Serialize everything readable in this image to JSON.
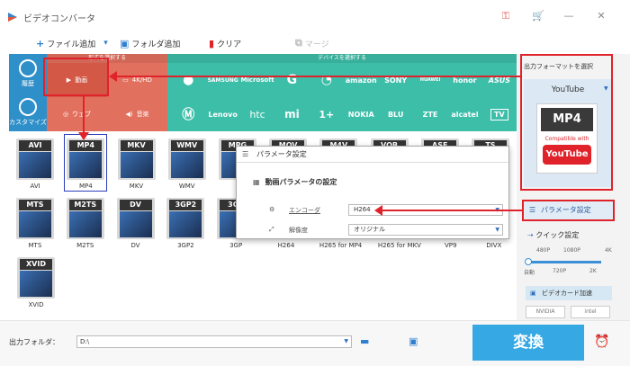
{
  "app": {
    "title": "ビデオコンバータ"
  },
  "toolbar": {
    "add_file": "ファイル追加",
    "add_folder": "フォルダ追加",
    "clear": "クリア",
    "merge": "マージ"
  },
  "nav": {
    "history": "履歴",
    "customize": "カスタマイズ"
  },
  "sections": {
    "format_header": "形式を選択する",
    "device_header": "デバイスを選択する"
  },
  "categories": [
    "動画",
    "4K/HD",
    "ウェブ",
    "音楽"
  ],
  "devices": {
    "row1": [
      "",
      "SAMSUNG",
      "Microsoft",
      "G",
      "",
      "amazon",
      "SONY",
      "HUAWEI",
      "honor",
      "ASUS"
    ],
    "row2": [
      "",
      "Lenovo",
      "htc",
      "mi",
      "1+",
      "NOKIA",
      "BLU",
      "ZTE",
      "alcatel",
      "TV"
    ]
  },
  "formats": {
    "row1": [
      {
        "tag": "AVI",
        "label": "AVI"
      },
      {
        "tag": "MP4",
        "label": "MP4"
      },
      {
        "tag": "MKV",
        "label": "MKV"
      },
      {
        "tag": "WMV",
        "label": "WMV"
      },
      {
        "tag": "MPG",
        "label": ""
      },
      {
        "tag": "MOV",
        "label": ""
      },
      {
        "tag": "M4V",
        "label": ""
      },
      {
        "tag": "VOB",
        "label": ""
      },
      {
        "tag": "ASF",
        "label": ""
      },
      {
        "tag": "TS",
        "label": ""
      }
    ],
    "row2": [
      {
        "tag": "MTS",
        "label": "MTS"
      },
      {
        "tag": "M2TS",
        "label": "M2TS"
      },
      {
        "tag": "DV",
        "label": "DV"
      },
      {
        "tag": "3GP2",
        "label": "3GP2"
      },
      {
        "tag": "3GP",
        "label": "3GP"
      },
      {
        "tag": "",
        "label": "H264"
      },
      {
        "tag": "",
        "label": "H265 for MP4"
      },
      {
        "tag": "",
        "label": "H265 for MKV"
      },
      {
        "tag": "",
        "label": "VP9"
      },
      {
        "tag": "",
        "label": "DIVX"
      }
    ],
    "row3": [
      {
        "tag": "XVID",
        "label": "XVID"
      }
    ]
  },
  "dialog": {
    "title": "パラメータ設定",
    "section": "動画パラメータの設定",
    "encoder_label": "エンコーダ",
    "encoder_value": "H264",
    "resolution_label": "解像度",
    "resolution_value": "オリジナル"
  },
  "right": {
    "output_format_label": "出力フォーマットを選択",
    "format_name": "YouTube",
    "card_top": "MP4",
    "card_mid": "Compatible with",
    "card_bottom": "YouTube",
    "param_button": "パラメータ設定",
    "quick_label": "クイック設定",
    "quick_top": [
      "480P",
      "1080P",
      "4K"
    ],
    "quick_bottom": [
      "自動",
      "720P",
      "2K"
    ],
    "gpu_label": "ビデオカード加速",
    "vendors": [
      "NVIDIA",
      "intel"
    ]
  },
  "bottom": {
    "output_folder_label": "出力フォルダ：",
    "path": "D:\\",
    "convert": "変換"
  },
  "colors": {
    "accent": "#36a8e3",
    "red": "#e0232b",
    "category_bg": "#e2705f",
    "device_bg": "#3dbea9",
    "nav_bg": "#2f8fc9"
  }
}
